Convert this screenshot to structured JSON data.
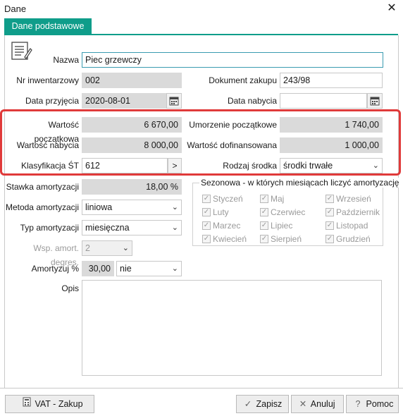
{
  "window": {
    "title": "Dane",
    "close": "✕"
  },
  "tabs": [
    {
      "label": "Dane podstawowe"
    }
  ],
  "form": {
    "nazwa": {
      "label": "Nazwa",
      "value": "Piec grzewczy"
    },
    "nr_inwentarzowy": {
      "label": "Nr inwentarzowy",
      "value": "002"
    },
    "dokument_zakupu": {
      "label": "Dokument zakupu",
      "value": "243/98"
    },
    "data_przyjecia": {
      "label": "Data przyjęcia",
      "value": "2020-08-01"
    },
    "data_nabycia": {
      "label": "Data nabycia",
      "value": ""
    },
    "wartosc_poczatkowa": {
      "label": "Wartość początkowa",
      "value": "6 670,00"
    },
    "umorzenie_poczatkowe": {
      "label": "Umorzenie początkowe",
      "value": "1 740,00"
    },
    "wartosc_nabycia": {
      "label": "Wartość nabycia",
      "value": "8 000,00"
    },
    "wartosc_dofinansowana": {
      "label": "Wartość dofinansowana",
      "value": "1 000,00"
    },
    "klasyfikacja_st": {
      "label": "Klasyfikacja ŚT",
      "value": "612",
      "button": ">"
    },
    "rodzaj_srodka": {
      "label": "Rodzaj środka",
      "value": "środki trwałe"
    },
    "stawka_amortyzacji": {
      "label": "Stawka amortyzacji",
      "value": "18,00 %"
    },
    "metoda_amortyzacji": {
      "label": "Metoda amortyzacji",
      "value": "liniowa"
    },
    "typ_amortyzacji": {
      "label": "Typ amortyzacji",
      "value": "miesięczna"
    },
    "wsp_amort_degres": {
      "label": "Wsp. amort. degres.",
      "value": "2"
    },
    "amortyzuj": {
      "label": "Amortyzuj %",
      "value": "30,00",
      "select": "nie"
    },
    "opis": {
      "label": "Opis",
      "value": ""
    }
  },
  "seasonal": {
    "title": "Sezonowa - w których miesiącach liczyć amortyzację",
    "months": [
      "Styczeń",
      "Maj",
      "Wrzesień",
      "Luty",
      "Czerwiec",
      "Październik",
      "Marzec",
      "Lipiec",
      "Listopad",
      "Kwiecień",
      "Sierpień",
      "Grudzień"
    ]
  },
  "buttons": {
    "vat_zakup": "VAT - Zakup",
    "zapisz": "Zapisz",
    "anuluj": "Anuluj",
    "pomoc": "Pomoc"
  },
  "colors": {
    "accent": "#0f9d8a",
    "highlight": "#e03a3a"
  }
}
